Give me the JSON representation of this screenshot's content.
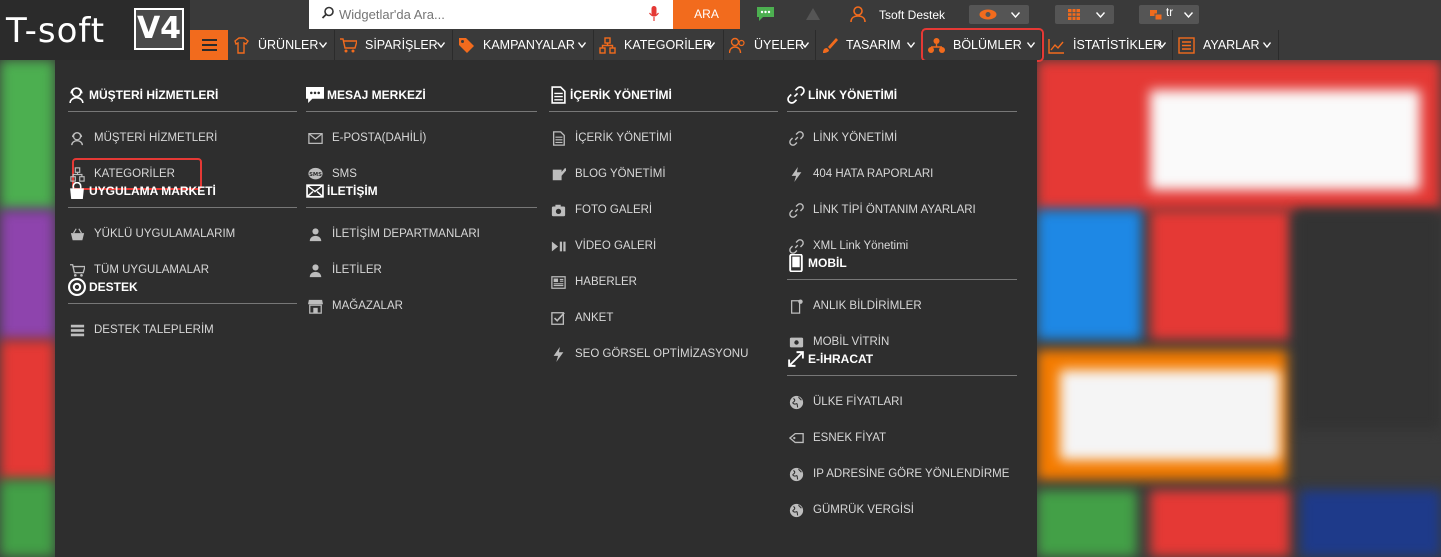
{
  "brand": {
    "logo_text": "T-soft",
    "version": "V4"
  },
  "search": {
    "placeholder": "Widgetlar'da Ara...",
    "value": "",
    "button": "ARA"
  },
  "user": {
    "name": "Tsoft Destek"
  },
  "language": {
    "value": "tr"
  },
  "nav": {
    "items": [
      {
        "label": "ÜRÜNLER",
        "icon": "product-icon"
      },
      {
        "label": "SİPARİŞLER",
        "icon": "cart-icon"
      },
      {
        "label": "KAMPANYALAR",
        "icon": "tag-icon"
      },
      {
        "label": "KATEGORİLER",
        "icon": "category-icon"
      },
      {
        "label": "ÜYELER",
        "icon": "users-icon"
      },
      {
        "label": "TASARIM",
        "icon": "brush-icon"
      },
      {
        "label": "BÖLÜMLER",
        "icon": "sections-icon"
      },
      {
        "label": "İSTATİSTİKLER",
        "icon": "stats-icon"
      },
      {
        "label": "AYARLAR",
        "icon": "settings-icon"
      }
    ]
  },
  "menu": {
    "col1": {
      "sections": [
        {
          "title": "MÜŞTERİ HİZMETLERİ",
          "icon": "support-agent-icon",
          "items": [
            {
              "label": "MÜŞTERİ HİZMETLERİ",
              "icon": "support-agent-icon"
            },
            {
              "label": "KATEGORİLER",
              "icon": "category-icon"
            }
          ]
        },
        {
          "title": "UYGULAMA MARKETİ",
          "icon": "shopping-bag-icon",
          "items": [
            {
              "label": "YÜKLÜ UYGULAMALARIM",
              "icon": "basket-icon"
            },
            {
              "label": "TÜM UYGULAMALAR",
              "icon": "cart-icon"
            }
          ]
        },
        {
          "title": "DESTEK",
          "icon": "lifebuoy-icon",
          "items": [
            {
              "label": "DESTEK TALEPLERİM",
              "icon": "list-icon"
            }
          ]
        }
      ]
    },
    "col2": {
      "sections": [
        {
          "title": "MESAJ MERKEZİ",
          "icon": "chat-icon",
          "items": [
            {
              "label": "E-POSTA(DAHİLİ)",
              "icon": "mail-icon"
            },
            {
              "label": "SMS",
              "icon": "sms-icon"
            }
          ]
        },
        {
          "title": "İLETİŞİM",
          "icon": "envelope-icon",
          "items": [
            {
              "label": "İLETİŞİM DEPARTMANLARI",
              "icon": "person-icon"
            },
            {
              "label": "İLETİLER",
              "icon": "person-icon"
            },
            {
              "label": "MAĞAZALAR",
              "icon": "store-icon"
            }
          ]
        }
      ]
    },
    "col3": {
      "sections": [
        {
          "title": "İÇERİK YÖNETİMİ",
          "icon": "document-icon",
          "items": [
            {
              "label": "İÇERİK YÖNETİMİ",
              "icon": "document-icon"
            },
            {
              "label": "BLOG YÖNETİMİ",
              "icon": "blog-icon"
            },
            {
              "label": "FOTO GALERİ",
              "icon": "camera-icon"
            },
            {
              "label": "VİDEO GALERİ",
              "icon": "video-icon"
            },
            {
              "label": "HABERLER",
              "icon": "news-icon"
            },
            {
              "label": "ANKET",
              "icon": "checkbox-icon"
            },
            {
              "label": "SEO GÖRSEL OPTİMİZASYONU",
              "icon": "bolt-icon"
            }
          ]
        }
      ]
    },
    "col4": {
      "sections": [
        {
          "title": "LİNK YÖNETİMİ",
          "icon": "link-icon",
          "items": [
            {
              "label": "LİNK YÖNETİMİ",
              "icon": "link-icon"
            },
            {
              "label": "404 HATA RAPORLARI",
              "icon": "bolt-icon"
            },
            {
              "label": "LİNK TİPİ ÖNTANIM AYARLARI",
              "icon": "link-icon"
            },
            {
              "label": "XML Link Yönetimi",
              "icon": "link-icon"
            }
          ]
        },
        {
          "title": "MOBİL",
          "icon": "mobile-icon",
          "items": [
            {
              "label": "ANLIK BİLDİRİMLER",
              "icon": "notification-icon"
            },
            {
              "label": "MOBİL VİTRİN",
              "icon": "showcase-icon"
            }
          ]
        },
        {
          "title": "E-İHRACAT",
          "icon": "export-icon",
          "items": [
            {
              "label": "ÜLKE FİYATLARI",
              "icon": "globe-icon"
            },
            {
              "label": "ESNEK FİYAT",
              "icon": "price-tag-icon"
            },
            {
              "label": "IP ADRESİNE GÖRE YÖNLENDİRME",
              "icon": "globe-icon"
            },
            {
              "label": "GÜMRÜK VERGİSİ",
              "icon": "globe-icon"
            }
          ]
        }
      ]
    }
  }
}
